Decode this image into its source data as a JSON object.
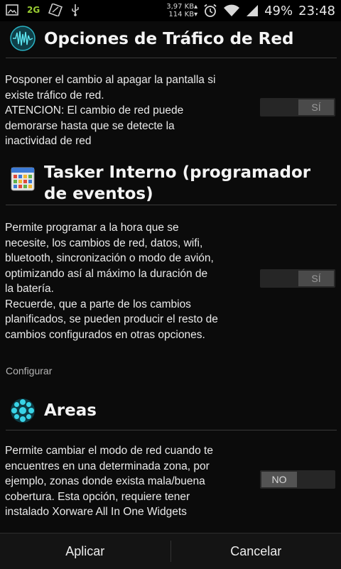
{
  "status_bar": {
    "network": "2G",
    "speed_up": "3,97 KB▴",
    "speed_down": "114 KB▾",
    "battery": "49%",
    "time": "23:48"
  },
  "sections": [
    {
      "title": "Opciones de Tráfico de Red",
      "icon": "network-traffic-icon",
      "description": "Posponer el cambio al apagar la pantalla si\nexiste tráfico de red.\nATENCION: El cambio de red puede\ndemorarse hasta que se detecte la\ninactividad de red",
      "toggle": "SÍ"
    },
    {
      "title": "Tasker Interno (programador de\neventos)",
      "icon": "calendar-icon",
      "description": "Permite programar a la hora que se\nnecesite, los cambios de red, datos, wifi,\nbluetooth, sincronización o modo de avión,\noptimizando así al máximo la duración de\nla batería.\nRecuerde, que a parte de los cambios\nplanificados, se pueden producir el resto de\ncambios configurados en otras opciones.",
      "toggle": "SÍ"
    },
    {
      "title": "Areas",
      "icon": "areas-icon",
      "description": "Permite cambiar el modo de red cuando te\nencuentres en una determinada zona, por\nejemplo, zonas donde exista mala/buena\ncobertura. Esta opción, requiere tener\ninstalado Xorware All In One Widgets",
      "toggle": "NO"
    }
  ],
  "category_label": "Configurar",
  "buttons": {
    "apply": "Aplicar",
    "cancel": "Cancelar"
  }
}
